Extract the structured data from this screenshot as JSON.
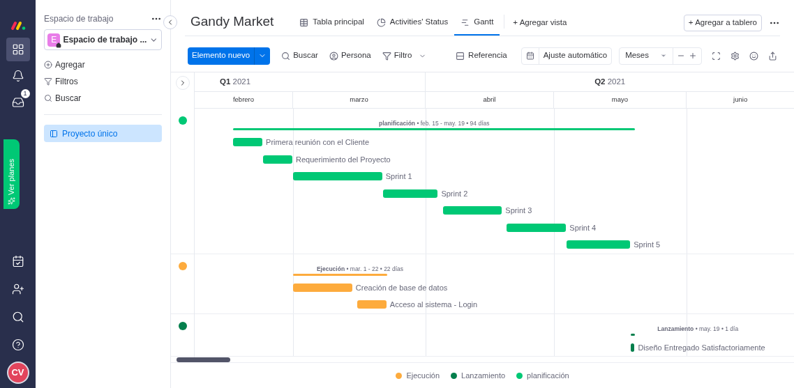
{
  "rail": {
    "top_items": [
      {
        "kind": "grid",
        "selected": true
      },
      {
        "kind": "bell",
        "selected": false
      },
      {
        "kind": "inbox",
        "selected": false,
        "badge": "1"
      }
    ],
    "upgrade": "Ver planes",
    "bottom_items": [
      {
        "kind": "calendar"
      },
      {
        "kind": "invite"
      },
      {
        "kind": "search"
      },
      {
        "kind": "help"
      }
    ],
    "avatar": "CV"
  },
  "sidebar": {
    "title": "Espacio de trabajo",
    "workspace": {
      "initial": "E",
      "name": "Espacio de trabajo ..."
    },
    "actions": [
      {
        "kind": "add",
        "label": "Agregar"
      },
      {
        "kind": "filter",
        "label": "Filtros"
      },
      {
        "kind": "search",
        "label": "Buscar"
      }
    ],
    "boards": [
      {
        "label": "Proyecto único",
        "selected": true
      }
    ]
  },
  "board": {
    "title": "Gandy Market",
    "views": [
      {
        "kind": "table",
        "label": "Tabla principal",
        "selected": false
      },
      {
        "kind": "chart",
        "label": "Activities' Status",
        "selected": false
      },
      {
        "kind": "gantt",
        "label": "Gantt",
        "selected": true
      }
    ],
    "add_view": "+ Agregar vista",
    "add_to_board": "+ Agregar a tablero"
  },
  "toolbar": {
    "new_item": "Elemento nuevo",
    "tools": [
      {
        "kind": "search",
        "label": "Buscar"
      },
      {
        "kind": "person",
        "label": "Persona"
      },
      {
        "kind": "filter",
        "label": "Filtro"
      }
    ],
    "reference": "Referencia",
    "auto_fit": "Ajuste automático",
    "scale": "Meses"
  },
  "gantt": {
    "quarters": [
      {
        "label": "Q1",
        "year": "2021"
      },
      {
        "label": "Q2",
        "year": "2021"
      }
    ],
    "months": [
      "febrero",
      "marzo",
      "abril",
      "mayo",
      "junio"
    ],
    "groups": [
      {
        "color": "#00c875",
        "summary": "**planificación** • feb. 15 - may. 19 • 94 días",
        "tasks": [
          {
            "label": "Primera reunión con el Cliente"
          },
          {
            "label": "Requerimiento del Proyecto"
          },
          {
            "label": "Sprint 1"
          },
          {
            "label": "Sprint 2"
          },
          {
            "label": "Sprint 3"
          },
          {
            "label": "Sprint 4"
          },
          {
            "label": "Sprint 5"
          }
        ]
      },
      {
        "color": "#fdab3d",
        "summary": "**Ejecución** • mar. 1 - 22 • 22 días",
        "tasks": [
          {
            "label": "Creación de base de datos"
          },
          {
            "label": "Acceso al sistema - Login"
          }
        ]
      },
      {
        "color": "#037f4c",
        "summary": "**Lanzamiento** • may. 19 • 1 día",
        "tasks": [
          {
            "label": "Diseño Entregado Satisfactoriamente"
          }
        ]
      }
    ]
  },
  "legend": [
    {
      "label": "Ejecución",
      "color": "#fdab3d"
    },
    {
      "label": "Lanzamiento",
      "color": "#037f4c"
    },
    {
      "label": "planificación",
      "color": "#00c875"
    }
  ]
}
